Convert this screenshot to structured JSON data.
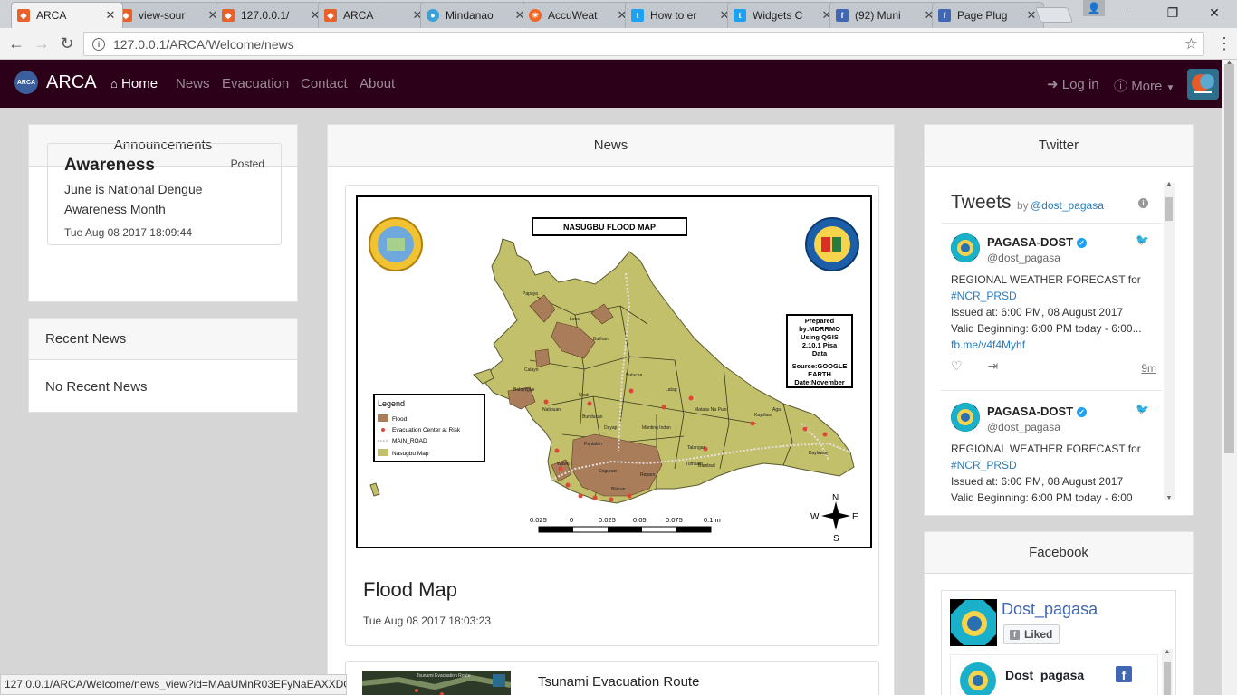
{
  "browser": {
    "tabs": [
      {
        "title": "ARCA",
        "icon": "codeigniter-icon",
        "active": true
      },
      {
        "title": "view-sour",
        "icon": "codeigniter-icon"
      },
      {
        "title": "127.0.0.1/",
        "icon": "codeigniter-icon"
      },
      {
        "title": "ARCA",
        "icon": "codeigniter-icon"
      },
      {
        "title": "Mindanao",
        "icon": "pagasa-icon"
      },
      {
        "title": "AccuWeat",
        "icon": "accuweather-icon"
      },
      {
        "title": "How to er",
        "icon": "twitter-icon"
      },
      {
        "title": "Widgets C",
        "icon": "twitter-icon"
      },
      {
        "title": "(92) Muni",
        "icon": "facebook-icon"
      },
      {
        "title": "Page Plug",
        "icon": "facebook-icon"
      }
    ],
    "url": "127.0.0.1/ARCA/Welcome/news",
    "status_url": "127.0.0.1/ARCA/Welcome/news_view?id=MAaUMnR03EFyNaEAXXDO"
  },
  "navbar": {
    "brand": "ARCA",
    "logo_text": "ARCA",
    "home": "Home",
    "news": "News",
    "evacuation": "Evacuation",
    "contact": "Contact",
    "about": "About",
    "login": "Log in",
    "more": "More"
  },
  "announcements": {
    "heading": "Announcements",
    "item": {
      "title": "Awareness",
      "posted": "Posted",
      "body": "June is National Dengue Awareness Month",
      "date": "Tue Aug 08 2017 18:09:44"
    }
  },
  "recent_news": {
    "heading": "Recent News",
    "empty": "No Recent News"
  },
  "news": {
    "heading": "News",
    "items": [
      {
        "title": "Flood Map",
        "date": "Tue Aug 08 2017 18:03:23",
        "map": {
          "title": "NASUGBU FLOOD MAP",
          "seal_text": "BAYAN NG NASUGBU",
          "prepared": [
            "Prepared",
            "by:MDRRMO",
            "Using QGIS",
            "2.10.1 Pisa",
            "Data",
            "Source:GOOGLE",
            "EARTH",
            "Date:November"
          ],
          "legend_title": "Legend",
          "legend_items": [
            "Flood",
            "Evacuation Center at Risk",
            "MAIN_ROAD",
            "Nasugbu Map"
          ],
          "scale_labels": [
            "0.025",
            "0",
            "0.025",
            "0.05",
            "0.075",
            "0.1 m"
          ],
          "compass": {
            "n": "N",
            "s": "S",
            "e": "E",
            "w": "W"
          },
          "places": [
            "Papaya",
            "Looc",
            "Bulihan",
            "Butucan",
            "Utod",
            "Latag",
            "Bunducan",
            "Dayap",
            "Kaylaway",
            "Aga",
            "Kayrilaw",
            "Mataas Na Pulo",
            "Munting Indan",
            "Cogunan",
            "Reparo",
            "Talangan",
            "Balaytigue",
            "Wawa",
            "Pantalan",
            "Bilaran",
            "Calayo",
            "Natipuan",
            "Tumalim",
            "Bambad"
          ],
          "colors": {
            "land": "#c2c06a",
            "flood": "#a97d5a",
            "dots": "#e0453a",
            "road": "#e8e1e3"
          }
        }
      },
      {
        "title": "Tsunami Evacuation Route",
        "thumb_text": "Tsunami Evacuation Route"
      }
    ]
  },
  "twitter": {
    "heading": "Twitter",
    "widget_title": "Tweets",
    "by": "by",
    "handle_link": "@dost_pagasa",
    "tweets": [
      {
        "name": "PAGASA-DOST",
        "handle": "@dost_pagasa",
        "line1": "REGIONAL WEATHER FORECAST for",
        "hashtag": "#NCR_PRSD",
        "line2": "Issued at: 6:00 PM, 08 August 2017",
        "line3": "Valid Beginning: 6:00 PM today - 6:00...",
        "link": "fb.me/v4f4Myhf",
        "time": "9m"
      },
      {
        "name": "PAGASA-DOST",
        "handle": "@dost_pagasa",
        "line1": "REGIONAL WEATHER FORECAST for",
        "hashtag": "#NCR_PRSD",
        "line2": "Issued at: 6:00 PM, 08 August 2017",
        "line3": "Valid Beginning: 6:00 PM today - 6:00"
      }
    ]
  },
  "facebook": {
    "heading": "Facebook",
    "page_name": "Dost_pagasa",
    "liked": "Liked",
    "post_name": "Dost_pagasa"
  },
  "colors": {
    "navbar_bg": "#2b0018",
    "nav_link": "#9b8b96",
    "twitter_blue": "#1da1f2",
    "link_blue": "#2b7bb9",
    "facebook_blue": "#4267b2"
  }
}
